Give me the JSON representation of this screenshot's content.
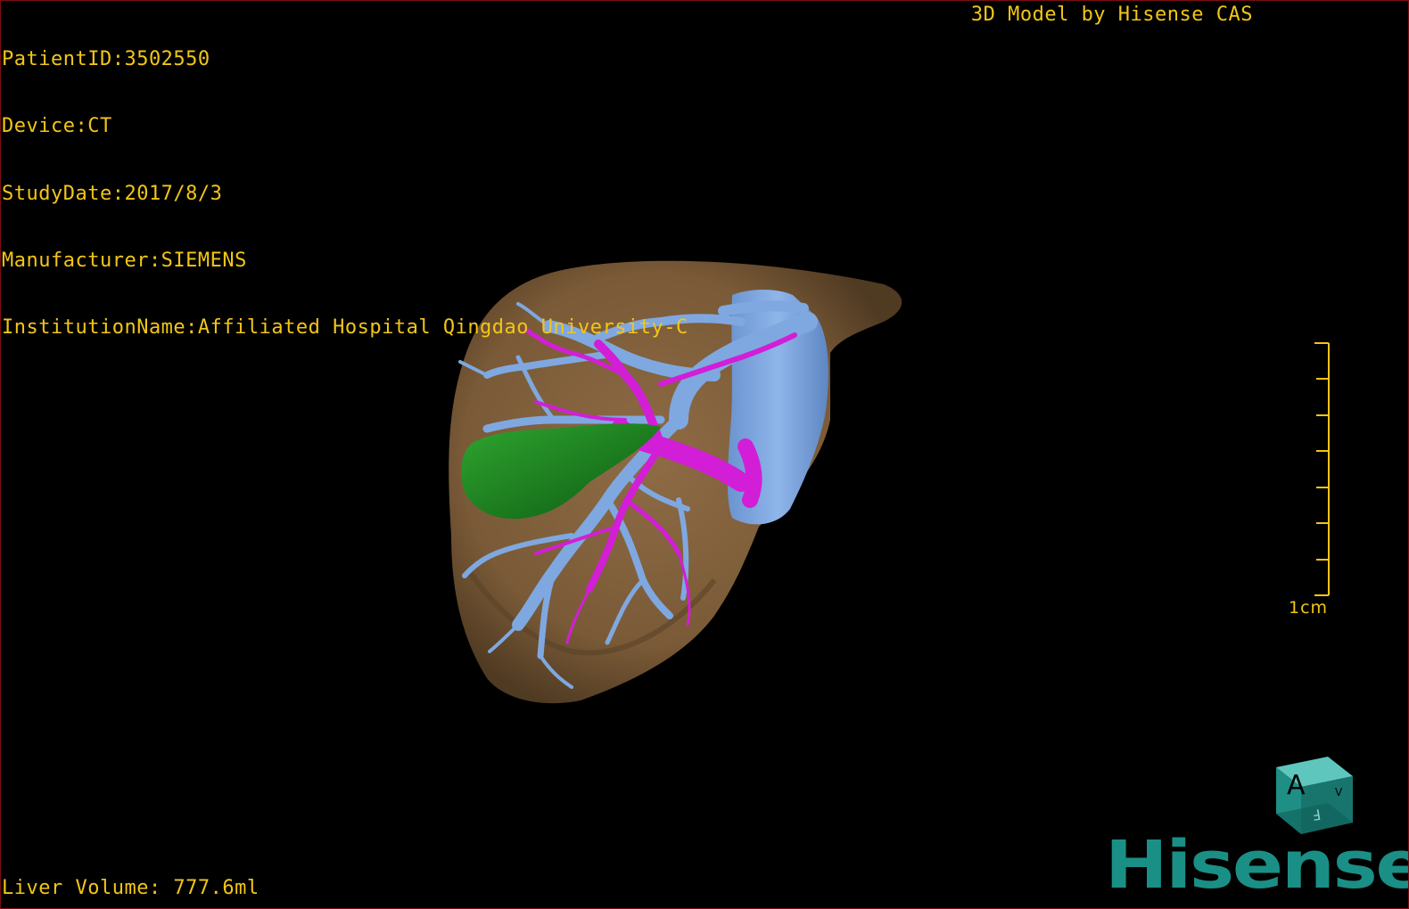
{
  "viewer": {
    "patient_id": "PatientID:3502550",
    "device": "Device:CT",
    "study_date": "StudyDate:2017/8/3",
    "manufacturer": "Manufacturer:SIEMENS",
    "institution": "InstitutionName:Affiliated Hospital Qingdao University-C",
    "title": "3D Model by Hisense CAS",
    "liver_volume": "Liver Volume: 777.6ml",
    "scale_label": "1cm",
    "brand": "Hisense"
  },
  "orientation_cube": {
    "front_label": "A",
    "bottom_label": "F",
    "side_label": "V"
  },
  "colors": {
    "overlay_text": "#f2c617",
    "liver": "#7a5a37",
    "portal_vein": "#7fa8e0",
    "hepatic_artery": "#d21ed6",
    "gallbladder": "#1f8a1f",
    "brand": "#1a8f86",
    "cube": "#1f8f86"
  }
}
